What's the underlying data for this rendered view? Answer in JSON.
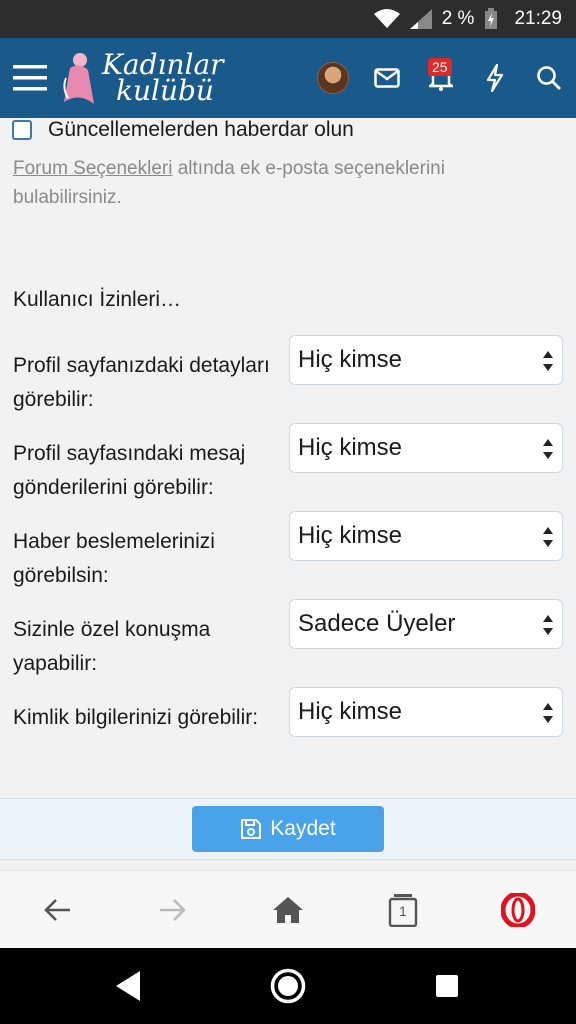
{
  "status_bar": {
    "battery": "2 %",
    "time": "21:29"
  },
  "header": {
    "logo_line1": "Kadınlar",
    "logo_line2": "kulübü",
    "notification_count": "25"
  },
  "form": {
    "checkbox_label": "Güncellemelerden haberdar olun",
    "help_link": "Forum Seçenekleri",
    "help_text": " altında ek e-posta seçeneklerini bulabilirsiniz.",
    "section_title": "Kullanıcı İzinleri…",
    "permissions": [
      {
        "label": "Profil sayfanızdaki detayları görebilir:",
        "value": "Hiç kimse"
      },
      {
        "label": "Profil sayfasındaki mesaj gönderilerini görebilir:",
        "value": "Hiç kimse"
      },
      {
        "label": "Haber beslemelerinizi görebilsin:",
        "value": "Hiç kimse"
      },
      {
        "label": "Sizinle özel konuşma yapabilir:",
        "value": "Sadece Üyeler"
      },
      {
        "label": "Kimlik bilgilerinizi görebilir:",
        "value": "Hiç kimse"
      }
    ],
    "save_label": "Kaydet"
  },
  "browser": {
    "tab_count": "1"
  },
  "colors": {
    "header": "#1a5a8a",
    "accent": "#4aa3e8",
    "opera": "#e3101e"
  }
}
